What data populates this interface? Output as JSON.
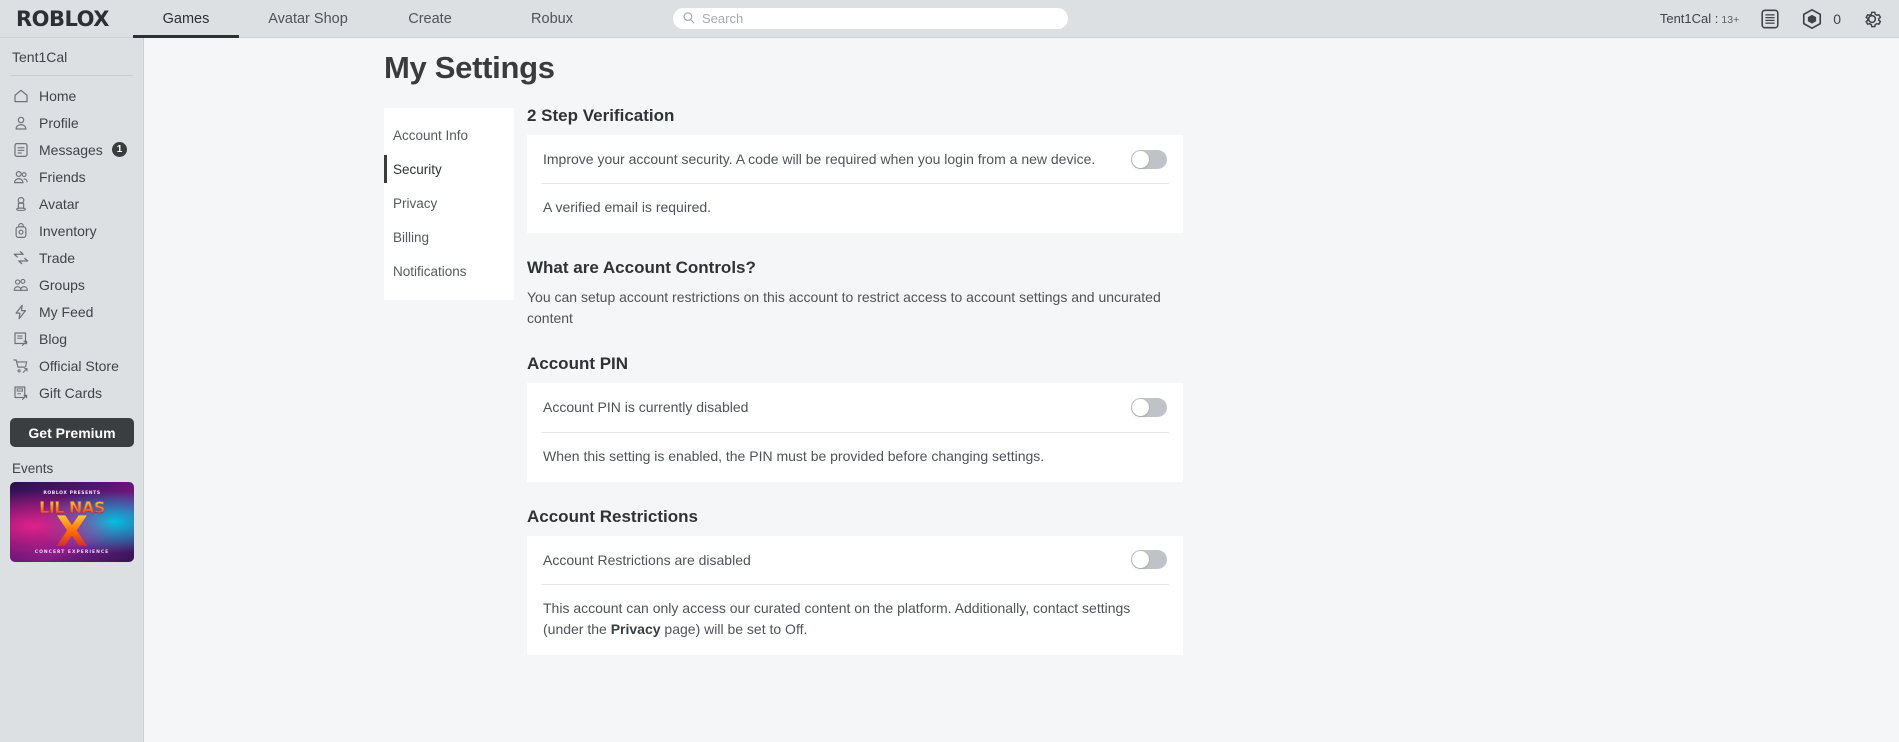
{
  "header": {
    "logo": "ROBLOX",
    "tabs": [
      {
        "label": "Games",
        "active": true
      },
      {
        "label": "Avatar Shop",
        "active": false
      },
      {
        "label": "Create",
        "active": false
      },
      {
        "label": "Robux",
        "active": false
      }
    ],
    "search_placeholder": "Search",
    "search_value": "",
    "username_label": "Tent1Cal :",
    "age_label": "13+",
    "robux_amount": "0",
    "icons": {
      "list": "list-icon",
      "robux": "robux-icon",
      "gear": "gear-icon",
      "search": "search-icon"
    }
  },
  "sidebar": {
    "username": "Tent1Cal",
    "items": [
      {
        "label": "Home",
        "icon": "home-icon",
        "badge": ""
      },
      {
        "label": "Profile",
        "icon": "profile-icon",
        "badge": ""
      },
      {
        "label": "Messages",
        "icon": "messages-icon",
        "badge": "1"
      },
      {
        "label": "Friends",
        "icon": "friends-icon",
        "badge": ""
      },
      {
        "label": "Avatar",
        "icon": "avatar-icon",
        "badge": ""
      },
      {
        "label": "Inventory",
        "icon": "inventory-icon",
        "badge": ""
      },
      {
        "label": "Trade",
        "icon": "trade-icon",
        "badge": ""
      },
      {
        "label": "Groups",
        "icon": "groups-icon",
        "badge": ""
      },
      {
        "label": "My Feed",
        "icon": "feed-icon",
        "badge": ""
      },
      {
        "label": "Blog",
        "icon": "blog-icon",
        "badge": ""
      },
      {
        "label": "Official Store",
        "icon": "store-icon",
        "badge": ""
      },
      {
        "label": "Gift Cards",
        "icon": "giftcard-icon",
        "badge": ""
      }
    ],
    "premium_button": "Get Premium",
    "events_label": "Events",
    "event_banner": {
      "presenter": "ROBLOX PRESENTS",
      "title": "LIL NAS",
      "x": "X",
      "subtitle": "CONCERT EXPERIENCE"
    }
  },
  "main": {
    "page_title": "My Settings",
    "tabs": [
      {
        "label": "Account Info",
        "active": false
      },
      {
        "label": "Security",
        "active": true
      },
      {
        "label": "Privacy",
        "active": false
      },
      {
        "label": "Billing",
        "active": false
      },
      {
        "label": "Notifications",
        "active": false
      }
    ],
    "two_step": {
      "heading": "2 Step Verification",
      "description": "Improve your account security. A code will be required when you login from a new device.",
      "note": "A verified email is required.",
      "toggle_state": "off"
    },
    "account_controls": {
      "heading": "What are Account Controls?",
      "description": "You can setup account restrictions on this account to restrict access to account settings and uncurated content"
    },
    "account_pin": {
      "heading": "Account PIN",
      "status": "Account PIN is currently disabled",
      "note": "When this setting is enabled, the PIN must be provided before changing settings.",
      "toggle_state": "off"
    },
    "account_restrictions": {
      "heading": "Account Restrictions",
      "status": "Account Restrictions are disabled",
      "note_part1": "This account can only access our curated content on the platform. Additionally, contact settings (under the ",
      "note_link": "Privacy",
      "note_part2": " page) will be set to Off.",
      "toggle_state": "off"
    }
  },
  "colors": {
    "header_bg": "#dde0e3",
    "page_bg": "#f5f6f7",
    "card_bg": "#ffffff",
    "accent_dark": "#393b3d",
    "text": "#4f5458"
  }
}
